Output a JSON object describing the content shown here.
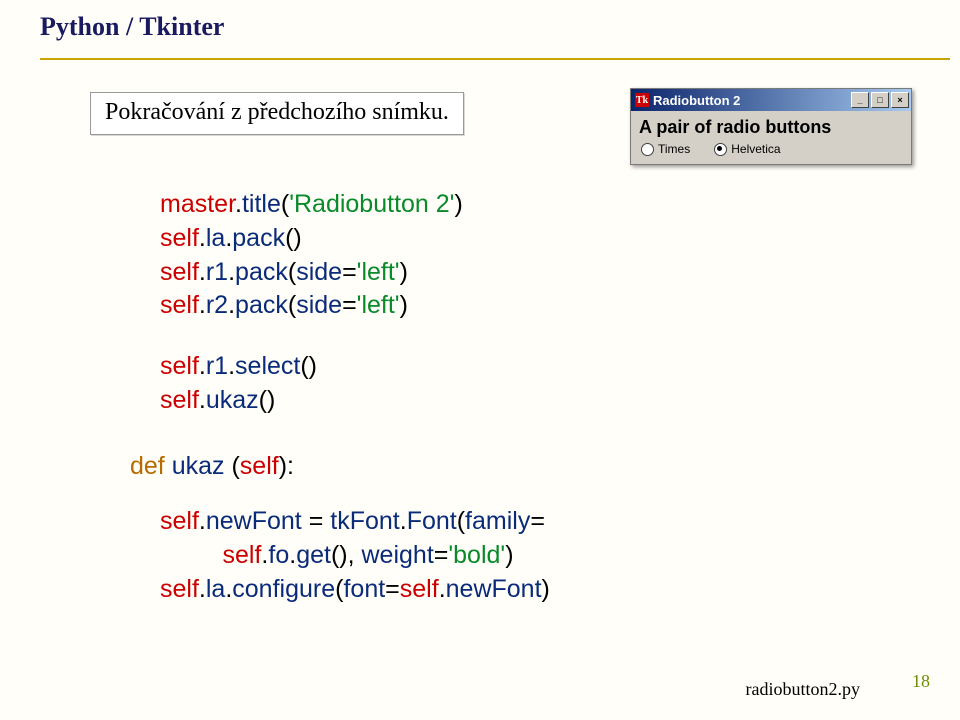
{
  "title": "Python / Tkinter",
  "notebox": "Pokračování z předchozího snímku.",
  "tkwindow": {
    "titlebar": "Radiobutton 2",
    "label": "A pair of radio buttons",
    "options": [
      "Times",
      "Helvetica"
    ],
    "selected_index": 1
  },
  "code": {
    "block1": [
      [
        [
          "obj",
          "master"
        ],
        [
          "punct",
          "."
        ],
        [
          "fn",
          "title"
        ],
        [
          "punct",
          "("
        ],
        [
          "str",
          "'Radiobutton 2'"
        ],
        [
          "punct",
          ")"
        ]
      ],
      [
        [
          "obj",
          "self"
        ],
        [
          "punct",
          "."
        ],
        [
          "fn",
          "la"
        ],
        [
          "punct",
          "."
        ],
        [
          "fn",
          "pack"
        ],
        [
          "punct",
          "()"
        ]
      ],
      [
        [
          "obj",
          "self"
        ],
        [
          "punct",
          "."
        ],
        [
          "fn",
          "r1"
        ],
        [
          "punct",
          "."
        ],
        [
          "fn",
          "pack"
        ],
        [
          "punct",
          "("
        ],
        [
          "fn",
          "side"
        ],
        [
          "punct",
          "="
        ],
        [
          "str",
          "'left'"
        ],
        [
          "punct",
          ")"
        ]
      ],
      [
        [
          "obj",
          "self"
        ],
        [
          "punct",
          "."
        ],
        [
          "fn",
          "r2"
        ],
        [
          "punct",
          "."
        ],
        [
          "fn",
          "pack"
        ],
        [
          "punct",
          "("
        ],
        [
          "fn",
          "side"
        ],
        [
          "punct",
          "="
        ],
        [
          "str",
          "'left'"
        ],
        [
          "punct",
          ")"
        ]
      ]
    ],
    "block2": [
      [
        [
          "obj",
          "self"
        ],
        [
          "punct",
          "."
        ],
        [
          "fn",
          "r1"
        ],
        [
          "punct",
          "."
        ],
        [
          "fn",
          "select"
        ],
        [
          "punct",
          "()"
        ]
      ],
      [
        [
          "obj",
          "self"
        ],
        [
          "punct",
          "."
        ],
        [
          "fn",
          "ukaz"
        ],
        [
          "punct",
          "()"
        ]
      ]
    ],
    "block3": [
      [
        [
          "kw",
          "def "
        ],
        [
          "fn",
          "ukaz "
        ],
        [
          "punct",
          "("
        ],
        [
          "obj",
          "self"
        ],
        [
          "punct",
          "):"
        ]
      ]
    ],
    "block4": [
      [
        [
          "obj",
          "self"
        ],
        [
          "punct",
          "."
        ],
        [
          "fn",
          "newFont "
        ],
        [
          "punct",
          "= "
        ],
        [
          "fn",
          "tkFont"
        ],
        [
          "punct",
          "."
        ],
        [
          "fn",
          "Font"
        ],
        [
          "punct",
          "("
        ],
        [
          "fn",
          "family"
        ],
        [
          "punct",
          "="
        ]
      ],
      [
        [
          "txt",
          "         "
        ],
        [
          "obj",
          "self"
        ],
        [
          "punct",
          "."
        ],
        [
          "fn",
          "fo"
        ],
        [
          "punct",
          "."
        ],
        [
          "fn",
          "get"
        ],
        [
          "punct",
          "(), "
        ],
        [
          "fn",
          "weight"
        ],
        [
          "punct",
          "="
        ],
        [
          "str",
          "'bold'"
        ],
        [
          "punct",
          ")"
        ]
      ],
      [
        [
          "obj",
          "self"
        ],
        [
          "punct",
          "."
        ],
        [
          "fn",
          "la"
        ],
        [
          "punct",
          "."
        ],
        [
          "fn",
          "configure"
        ],
        [
          "punct",
          "("
        ],
        [
          "fn",
          "font"
        ],
        [
          "punct",
          "="
        ],
        [
          "obj",
          "self"
        ],
        [
          "punct",
          "."
        ],
        [
          "fn",
          "newFont"
        ],
        [
          "punct",
          ")"
        ]
      ]
    ]
  },
  "footer": {
    "filename": "radiobutton2.py",
    "page": "18"
  }
}
